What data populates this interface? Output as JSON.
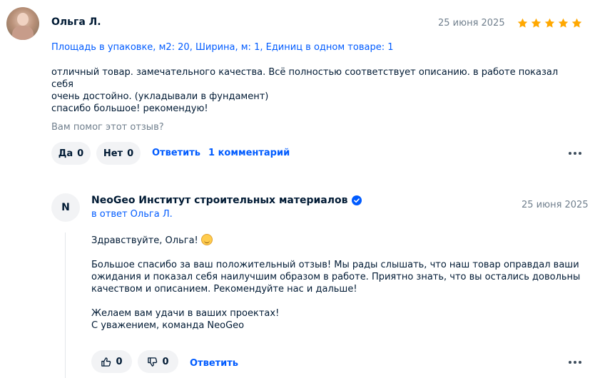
{
  "review": {
    "author": "Ольга Л.",
    "date": "25 июня 2025",
    "rating": 5,
    "star_color": "#ffa800",
    "variant": "Площадь в упаковке, м2: 20, Ширина, м: 1, Единиц в одном товаре: 1",
    "text_line1": "отличный товар. замечательного качества. Всё полностью соответствует описанию. в работе показал себя",
    "text_line2": "очень достойно. (укладывали в фундамент)",
    "text_line3": "спасибо большое! рекомендую!",
    "helpful_question": "Вам помог этот отзыв?",
    "yes_label": "Да",
    "yes_count": "0",
    "no_label": "Нет",
    "no_count": "0",
    "reply_link": "Ответить",
    "comments_link": "1 комментарий",
    "more_icon": "more-dots-icon"
  },
  "seller_reply": {
    "avatar_letter": "N",
    "name": "NeoGeo Институт строительных материалов",
    "verified_icon": "verified-check-icon",
    "accent_color": "#005bff",
    "reply_to": "в ответ Ольга Л.",
    "date": "25 июня 2025",
    "greeting": "Здравствуйте, Ольга!",
    "emoji_icon": "smile-emoji-icon",
    "para1_line1": "Большое спасибо за ваш положительный отзыв! Мы рады слышать, что наш товар оправдал ваши",
    "para1_line2": "ожидания и показал себя наилучшим образом в работе. Приятно знать, что вы остались довольны",
    "para1_line3": "качеством и описанием. Рекомендуйте нас и дальше!",
    "para2_line1": "Желаем вам удачи в ваших проектах!",
    "para2_line2": "С уважением, команда NeoGeo",
    "like_count": "0",
    "dislike_count": "0",
    "reply_link": "Ответить",
    "like_icon": "thumbs-up-icon",
    "dislike_icon": "thumbs-down-icon"
  }
}
